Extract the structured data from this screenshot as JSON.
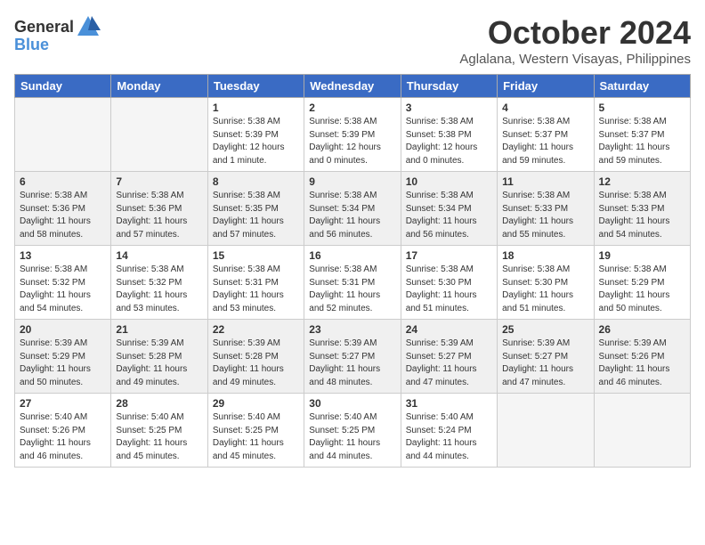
{
  "header": {
    "logo_general": "General",
    "logo_blue": "Blue",
    "month_title": "October 2024",
    "location": "Aglalana, Western Visayas, Philippines"
  },
  "weekdays": [
    "Sunday",
    "Monday",
    "Tuesday",
    "Wednesday",
    "Thursday",
    "Friday",
    "Saturday"
  ],
  "weeks": [
    [
      {
        "day": "",
        "info": ""
      },
      {
        "day": "",
        "info": ""
      },
      {
        "day": "1",
        "info": "Sunrise: 5:38 AM\nSunset: 5:39 PM\nDaylight: 12 hours\nand 1 minute."
      },
      {
        "day": "2",
        "info": "Sunrise: 5:38 AM\nSunset: 5:39 PM\nDaylight: 12 hours\nand 0 minutes."
      },
      {
        "day": "3",
        "info": "Sunrise: 5:38 AM\nSunset: 5:38 PM\nDaylight: 12 hours\nand 0 minutes."
      },
      {
        "day": "4",
        "info": "Sunrise: 5:38 AM\nSunset: 5:37 PM\nDaylight: 11 hours\nand 59 minutes."
      },
      {
        "day": "5",
        "info": "Sunrise: 5:38 AM\nSunset: 5:37 PM\nDaylight: 11 hours\nand 59 minutes."
      }
    ],
    [
      {
        "day": "6",
        "info": "Sunrise: 5:38 AM\nSunset: 5:36 PM\nDaylight: 11 hours\nand 58 minutes."
      },
      {
        "day": "7",
        "info": "Sunrise: 5:38 AM\nSunset: 5:36 PM\nDaylight: 11 hours\nand 57 minutes."
      },
      {
        "day": "8",
        "info": "Sunrise: 5:38 AM\nSunset: 5:35 PM\nDaylight: 11 hours\nand 57 minutes."
      },
      {
        "day": "9",
        "info": "Sunrise: 5:38 AM\nSunset: 5:34 PM\nDaylight: 11 hours\nand 56 minutes."
      },
      {
        "day": "10",
        "info": "Sunrise: 5:38 AM\nSunset: 5:34 PM\nDaylight: 11 hours\nand 56 minutes."
      },
      {
        "day": "11",
        "info": "Sunrise: 5:38 AM\nSunset: 5:33 PM\nDaylight: 11 hours\nand 55 minutes."
      },
      {
        "day": "12",
        "info": "Sunrise: 5:38 AM\nSunset: 5:33 PM\nDaylight: 11 hours\nand 54 minutes."
      }
    ],
    [
      {
        "day": "13",
        "info": "Sunrise: 5:38 AM\nSunset: 5:32 PM\nDaylight: 11 hours\nand 54 minutes."
      },
      {
        "day": "14",
        "info": "Sunrise: 5:38 AM\nSunset: 5:32 PM\nDaylight: 11 hours\nand 53 minutes."
      },
      {
        "day": "15",
        "info": "Sunrise: 5:38 AM\nSunset: 5:31 PM\nDaylight: 11 hours\nand 53 minutes."
      },
      {
        "day": "16",
        "info": "Sunrise: 5:38 AM\nSunset: 5:31 PM\nDaylight: 11 hours\nand 52 minutes."
      },
      {
        "day": "17",
        "info": "Sunrise: 5:38 AM\nSunset: 5:30 PM\nDaylight: 11 hours\nand 51 minutes."
      },
      {
        "day": "18",
        "info": "Sunrise: 5:38 AM\nSunset: 5:30 PM\nDaylight: 11 hours\nand 51 minutes."
      },
      {
        "day": "19",
        "info": "Sunrise: 5:38 AM\nSunset: 5:29 PM\nDaylight: 11 hours\nand 50 minutes."
      }
    ],
    [
      {
        "day": "20",
        "info": "Sunrise: 5:39 AM\nSunset: 5:29 PM\nDaylight: 11 hours\nand 50 minutes."
      },
      {
        "day": "21",
        "info": "Sunrise: 5:39 AM\nSunset: 5:28 PM\nDaylight: 11 hours\nand 49 minutes."
      },
      {
        "day": "22",
        "info": "Sunrise: 5:39 AM\nSunset: 5:28 PM\nDaylight: 11 hours\nand 49 minutes."
      },
      {
        "day": "23",
        "info": "Sunrise: 5:39 AM\nSunset: 5:27 PM\nDaylight: 11 hours\nand 48 minutes."
      },
      {
        "day": "24",
        "info": "Sunrise: 5:39 AM\nSunset: 5:27 PM\nDaylight: 11 hours\nand 47 minutes."
      },
      {
        "day": "25",
        "info": "Sunrise: 5:39 AM\nSunset: 5:27 PM\nDaylight: 11 hours\nand 47 minutes."
      },
      {
        "day": "26",
        "info": "Sunrise: 5:39 AM\nSunset: 5:26 PM\nDaylight: 11 hours\nand 46 minutes."
      }
    ],
    [
      {
        "day": "27",
        "info": "Sunrise: 5:40 AM\nSunset: 5:26 PM\nDaylight: 11 hours\nand 46 minutes."
      },
      {
        "day": "28",
        "info": "Sunrise: 5:40 AM\nSunset: 5:25 PM\nDaylight: 11 hours\nand 45 minutes."
      },
      {
        "day": "29",
        "info": "Sunrise: 5:40 AM\nSunset: 5:25 PM\nDaylight: 11 hours\nand 45 minutes."
      },
      {
        "day": "30",
        "info": "Sunrise: 5:40 AM\nSunset: 5:25 PM\nDaylight: 11 hours\nand 44 minutes."
      },
      {
        "day": "31",
        "info": "Sunrise: 5:40 AM\nSunset: 5:24 PM\nDaylight: 11 hours\nand 44 minutes."
      },
      {
        "day": "",
        "info": ""
      },
      {
        "day": "",
        "info": ""
      }
    ]
  ]
}
